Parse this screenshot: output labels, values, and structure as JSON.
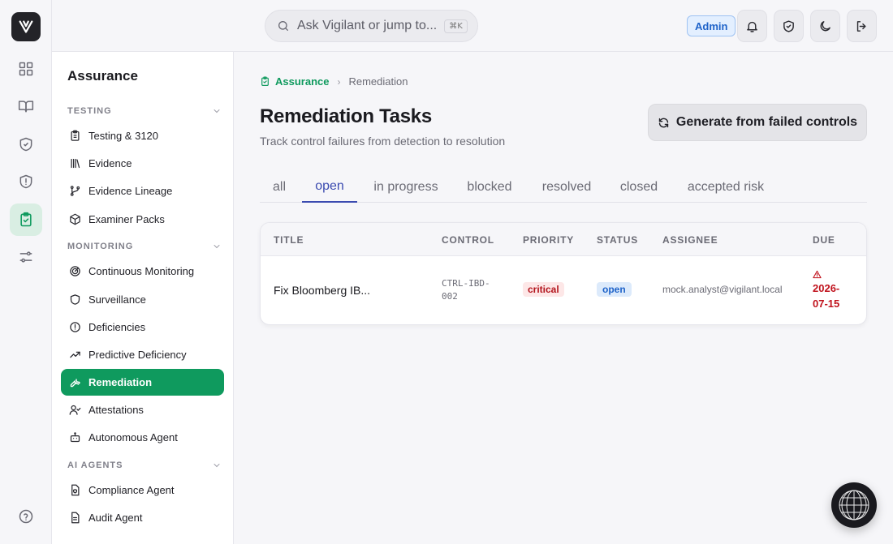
{
  "topbar": {
    "search_placeholder": "Ask Vigilant or jump to...",
    "search_shortcut": "⌘K",
    "role_badge": "Admin"
  },
  "sidebar": {
    "title": "Assurance",
    "sections": [
      {
        "label": "TESTING",
        "items": [
          {
            "label": "Testing & 3120",
            "icon": "clipboard-icon"
          },
          {
            "label": "Evidence",
            "icon": "library-icon"
          },
          {
            "label": "Evidence Lineage",
            "icon": "git-branch-icon"
          },
          {
            "label": "Examiner Packs",
            "icon": "package-icon"
          }
        ]
      },
      {
        "label": "MONITORING",
        "items": [
          {
            "label": "Continuous Monitoring",
            "icon": "radar-icon"
          },
          {
            "label": "Surveillance",
            "icon": "shield-icon"
          },
          {
            "label": "Deficiencies",
            "icon": "alert-circle-icon"
          },
          {
            "label": "Predictive Deficiency",
            "icon": "trending-up-icon"
          },
          {
            "label": "Remediation",
            "icon": "wrench-icon",
            "active": true
          },
          {
            "label": "Attestations",
            "icon": "user-check-icon"
          },
          {
            "label": "Autonomous Agent",
            "icon": "bot-icon"
          }
        ]
      },
      {
        "label": "AI AGENTS",
        "items": [
          {
            "label": "Compliance Agent",
            "icon": "file-shield-icon"
          },
          {
            "label": "Audit Agent",
            "icon": "file-text-icon"
          }
        ]
      }
    ]
  },
  "breadcrumb": {
    "parent": "Assurance",
    "current": "Remediation"
  },
  "page": {
    "title": "Remediation Tasks",
    "subtitle": "Track control failures from detection to resolution",
    "generate_button": "Generate from failed controls"
  },
  "tabs": [
    {
      "label": "all"
    },
    {
      "label": "open",
      "active": true
    },
    {
      "label": "in progress"
    },
    {
      "label": "blocked"
    },
    {
      "label": "resolved"
    },
    {
      "label": "closed"
    },
    {
      "label": "accepted risk"
    }
  ],
  "table": {
    "columns": [
      "TITLE",
      "CONTROL",
      "PRIORITY",
      "STATUS",
      "ASSIGNEE",
      "DUE"
    ],
    "rows": [
      {
        "title": "Fix Bloomberg IB...",
        "control_line1": "CTRL-IBD-",
        "control_line2": "002",
        "priority": "critical",
        "status": "open",
        "assignee": "mock.analyst@vigilant.local",
        "due_line1": "2026-",
        "due_line2": "07-15"
      }
    ]
  },
  "colors": {
    "accent": "#0f9a5e",
    "tab_active": "#3b4bb0",
    "critical": "#b3151d",
    "open_status": "#1f63c9"
  }
}
